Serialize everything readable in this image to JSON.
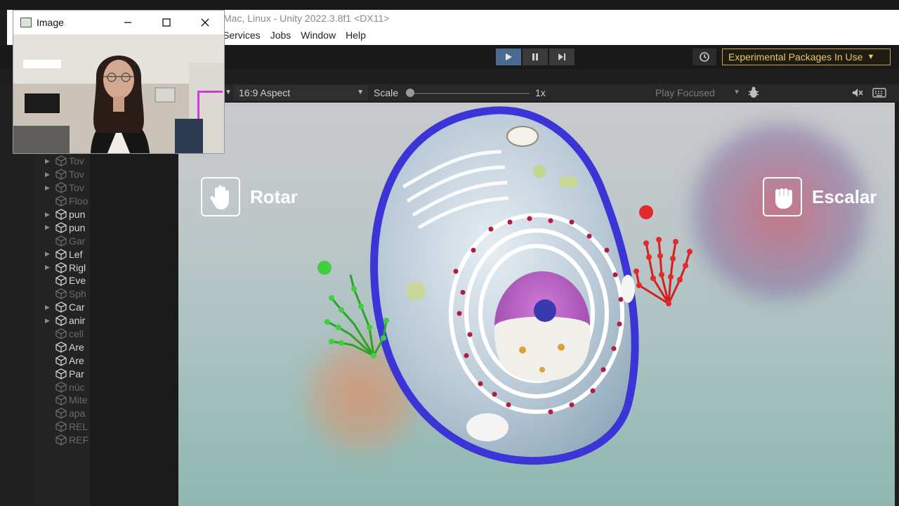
{
  "editor": {
    "window_title": "Mac, Linux - Unity 2022.3.8f1 <DX11>",
    "menu": [
      "Services",
      "Jobs",
      "Window",
      "Help"
    ],
    "experimental_label": "Experimental Packages In Use"
  },
  "game_view": {
    "aspect": "16:9 Aspect",
    "scale_label": "Scale",
    "scale_value": "1x",
    "play_focused": "Play Focused"
  },
  "hierarchy": {
    "items": [
      {
        "label": "Tov",
        "foldout": true,
        "active": false
      },
      {
        "label": "Tov",
        "foldout": true,
        "active": false
      },
      {
        "label": "Tov",
        "foldout": true,
        "active": false
      },
      {
        "label": "Floo",
        "foldout": false,
        "active": false
      },
      {
        "label": "pun",
        "foldout": true,
        "active": true
      },
      {
        "label": "pun",
        "foldout": true,
        "active": true
      },
      {
        "label": "Gar",
        "foldout": false,
        "active": false
      },
      {
        "label": "Lef",
        "foldout": true,
        "active": true
      },
      {
        "label": "Rigl",
        "foldout": true,
        "active": true
      },
      {
        "label": "Eve",
        "foldout": false,
        "active": true
      },
      {
        "label": "Sph",
        "foldout": false,
        "active": false
      },
      {
        "label": "Car",
        "foldout": true,
        "active": true
      },
      {
        "label": "anir",
        "foldout": true,
        "active": true
      },
      {
        "label": "cell",
        "foldout": false,
        "active": false
      },
      {
        "label": "Are",
        "foldout": false,
        "active": true
      },
      {
        "label": "Are",
        "foldout": false,
        "active": true
      },
      {
        "label": "Par",
        "foldout": false,
        "active": true
      },
      {
        "label": "núc",
        "foldout": false,
        "active": false
      },
      {
        "label": "Mite",
        "foldout": false,
        "active": false
      },
      {
        "label": "apa",
        "foldout": false,
        "active": false
      },
      {
        "label": "REL",
        "foldout": false,
        "active": false
      },
      {
        "label": "REF",
        "foldout": false,
        "active": false
      }
    ]
  },
  "scene": {
    "rotate_label": "Rotar",
    "scale_gesture_label": "Escalar"
  },
  "webcam": {
    "title": "Image"
  },
  "colors": {
    "accent_play": "#4a6a92",
    "experimental_gold": "#e8c662",
    "cell_membrane": "#3b34d6",
    "left_hand_tracking": "#2aa52a",
    "right_hand_tracking": "#d32020"
  }
}
